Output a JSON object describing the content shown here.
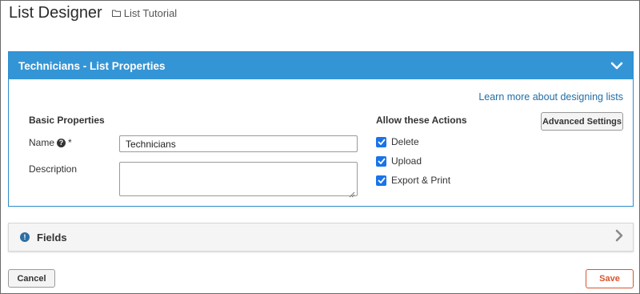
{
  "header": {
    "title": "List Designer",
    "breadcrumb": "List Tutorial",
    "breadcrumb_icon": "folder-icon"
  },
  "properties_panel": {
    "title": "Technicians - List Properties",
    "collapse_icon": "chevron-down-icon",
    "learn_link": "Learn more about designing lists",
    "basic_properties_heading": "Basic Properties",
    "name_label": "Name",
    "name_required": "*",
    "name_help_icon": "question-circle-icon",
    "name_value": "Technicians",
    "description_label": "Description",
    "description_value": "",
    "actions_heading": "Allow these Actions",
    "advanced_settings_label": "Advanced Settings",
    "actions": [
      {
        "label": "Delete",
        "checked": true
      },
      {
        "label": "Upload",
        "checked": true
      },
      {
        "label": "Export & Print",
        "checked": true
      }
    ]
  },
  "fields_panel": {
    "title": "Fields",
    "status_icon": "info-circle-icon",
    "expand_icon": "chevron-right-icon"
  },
  "footer": {
    "cancel_label": "Cancel",
    "save_label": "Save"
  },
  "colors": {
    "panel_header": "#3495d6",
    "panel_border": "#2d8ccb",
    "link": "#206fa8",
    "save_accent": "#d9542f",
    "checkbox": "#1a73e8"
  }
}
